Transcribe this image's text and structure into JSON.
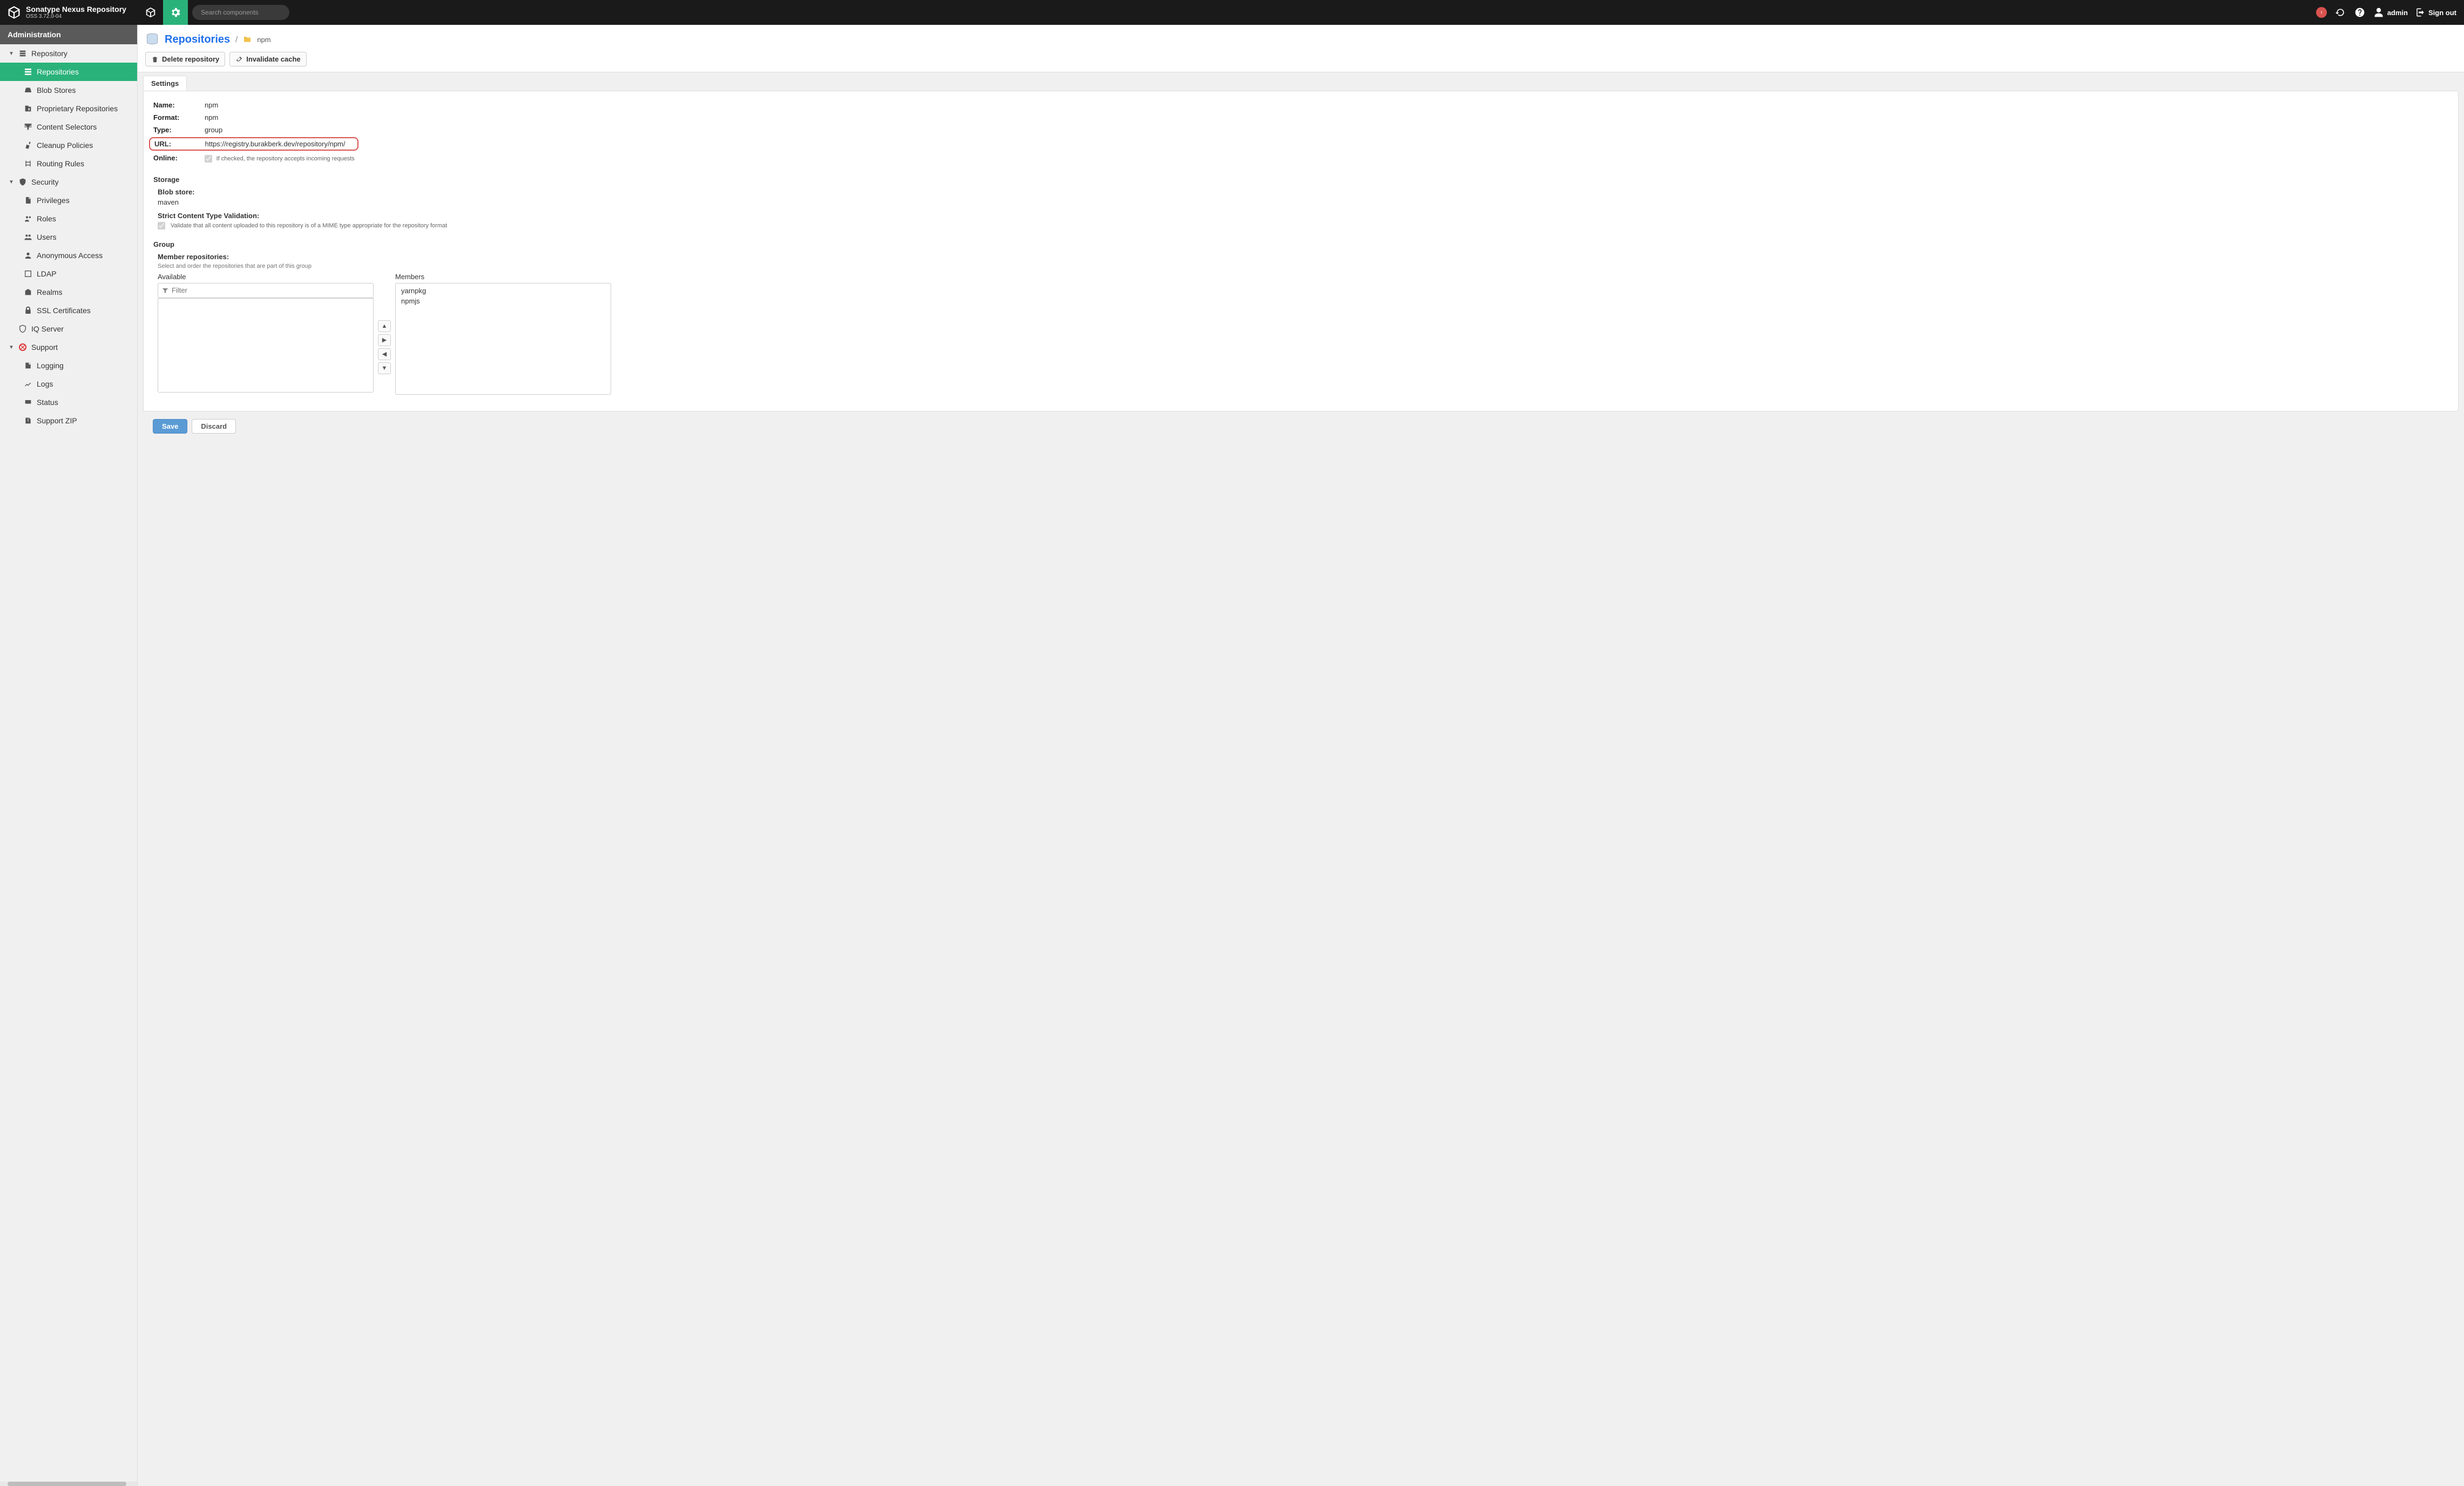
{
  "header": {
    "product_title": "Sonatype Nexus Repository",
    "product_sub": "OSS 3.72.0-04",
    "search_placeholder": "Search components",
    "user_label": "admin",
    "signout_label": "Sign out"
  },
  "sidebar": {
    "title": "Administration",
    "nodes": [
      {
        "id": "repository",
        "label": "Repository",
        "level": 1,
        "caret": true
      },
      {
        "id": "repositories",
        "label": "Repositories",
        "level": 2,
        "active": true
      },
      {
        "id": "blobstores",
        "label": "Blob Stores",
        "level": 2
      },
      {
        "id": "proprietary",
        "label": "Proprietary Repositories",
        "level": 2
      },
      {
        "id": "content-selectors",
        "label": "Content Selectors",
        "level": 2
      },
      {
        "id": "cleanup",
        "label": "Cleanup Policies",
        "level": 2
      },
      {
        "id": "routing",
        "label": "Routing Rules",
        "level": 2
      },
      {
        "id": "security",
        "label": "Security",
        "level": 1,
        "caret": true
      },
      {
        "id": "privileges",
        "label": "Privileges",
        "level": 2
      },
      {
        "id": "roles",
        "label": "Roles",
        "level": 2
      },
      {
        "id": "users",
        "label": "Users",
        "level": 2
      },
      {
        "id": "anon",
        "label": "Anonymous Access",
        "level": 2
      },
      {
        "id": "ldap",
        "label": "LDAP",
        "level": 2
      },
      {
        "id": "realms",
        "label": "Realms",
        "level": 2
      },
      {
        "id": "ssl",
        "label": "SSL Certificates",
        "level": 2
      },
      {
        "id": "iq",
        "label": "IQ Server",
        "level": 1
      },
      {
        "id": "support",
        "label": "Support",
        "level": 1,
        "caret": true
      },
      {
        "id": "logging",
        "label": "Logging",
        "level": 2
      },
      {
        "id": "logs",
        "label": "Logs",
        "level": 2
      },
      {
        "id": "status",
        "label": "Status",
        "level": 2
      },
      {
        "id": "support-zip",
        "label": "Support ZIP",
        "level": 2
      }
    ]
  },
  "breadcrumb": {
    "main": "Repositories",
    "leaf": "npm"
  },
  "toolbar": {
    "delete_label": "Delete repository",
    "invalidate_label": "Invalidate cache"
  },
  "tabs": {
    "settings": "Settings"
  },
  "details": {
    "name_label": "Name:",
    "name_value": "npm",
    "format_label": "Format:",
    "format_value": "npm",
    "type_label": "Type:",
    "type_value": "group",
    "url_label": "URL:",
    "url_value": "https://registry.burakberk.dev/repository/npm/",
    "online_label": "Online:",
    "online_help": "If checked, the repository accepts incoming requests"
  },
  "storage": {
    "title": "Storage",
    "blob_label": "Blob store:",
    "blob_value": "maven",
    "strict_label": "Strict Content Type Validation:",
    "strict_help": "Validate that all content uploaded to this repository is of a MIME type appropriate for the repository format"
  },
  "group": {
    "title": "Group",
    "member_label": "Member repositories:",
    "member_help": "Select and order the repositories that are part of this group",
    "available_title": "Available",
    "members_title": "Members",
    "filter_placeholder": "Filter",
    "available_items": [],
    "member_items": [
      "yarnpkg",
      "npmjs"
    ]
  },
  "footer": {
    "save": "Save",
    "discard": "Discard"
  }
}
